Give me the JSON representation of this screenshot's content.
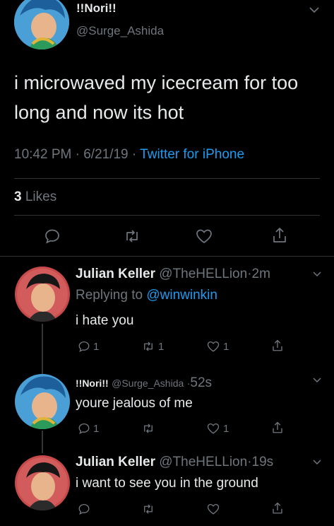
{
  "main_tweet": {
    "display_name": "!!Nori!!",
    "handle": "@Surge_Ashida",
    "text_line1": "i microwaved my icecream for too",
    "text_line2": "long and now its hot",
    "time": "10:42 PM",
    "sep1": "·",
    "date": "6/21/19",
    "sep2": "·",
    "source": "Twitter for iPhone",
    "likes_count": "3",
    "likes_label": "Likes"
  },
  "replies": [
    {
      "display_name": "Julian Keller",
      "handle": "@TheHELLion",
      "sep": "·",
      "time": "2m",
      "replying_prefix": "Replying to",
      "replying_to": "@winwinkin",
      "text": "i hate you",
      "reply_count": "1",
      "retweet_count": "1",
      "like_count": "1"
    },
    {
      "display_name": "!!Nori!!",
      "handle": "@Surge_Ashida",
      "sep": "·",
      "time": "52s",
      "text": "youre jealous of me",
      "reply_count": "1",
      "retweet_count": "",
      "like_count": "1"
    },
    {
      "display_name": "Julian Keller",
      "handle": "@TheHELLion",
      "sep": "·",
      "time": "19s",
      "text": "i want to see you in the ground",
      "reply_count": "",
      "retweet_count": "",
      "like_count": ""
    }
  ],
  "colors": {
    "background": "#000000",
    "text": "#e7e9ea",
    "muted": "#6e767d",
    "link": "#1d9bf0"
  }
}
